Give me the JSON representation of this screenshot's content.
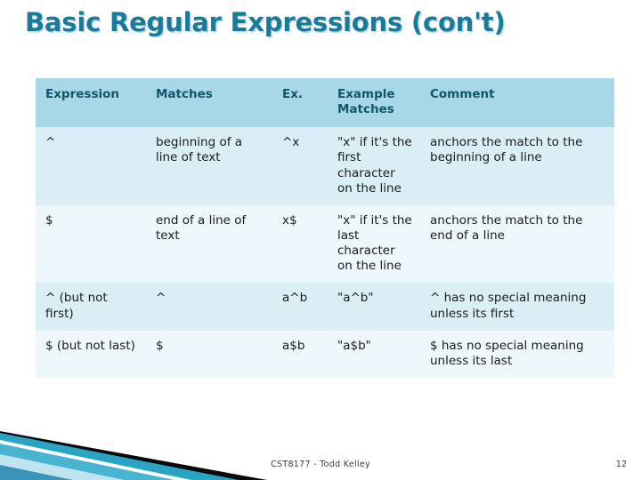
{
  "slide": {
    "title": "Basic Regular Expressions (con't)",
    "title_color": "#1a7a9a",
    "header_bg": "#a8d8e8",
    "row_bg_odd": "#daeef5",
    "row_bg_even": "#eef7fb",
    "footer": "CST8177 - Todd Kelley",
    "page_number": "12"
  },
  "table": {
    "headers": [
      "Expression",
      "Matches",
      "Ex.",
      "Example Matches",
      "Comment"
    ],
    "rows": [
      {
        "expression": "^",
        "matches": "beginning of a line of text",
        "ex": "^x",
        "example_matches": "\"x\" if it's the first character on the line",
        "comment": "anchors the match to the beginning of a line"
      },
      {
        "expression": "$",
        "matches": "end of a line of text",
        "ex": "x$",
        "example_matches": "\"x\" if it's the last character on the line",
        "comment": "anchors the match to the end of a line"
      },
      {
        "expression": "^ (but not first)",
        "matches": "^",
        "ex": "a^b",
        "example_matches": "\"a^b\"",
        "comment": "^ has no special meaning unless its first"
      },
      {
        "expression": "$ (but not last)",
        "matches": "$",
        "ex": "a$b",
        "example_matches": "\"a$b\"",
        "comment": "$ has no special meaning unless its last"
      }
    ]
  }
}
